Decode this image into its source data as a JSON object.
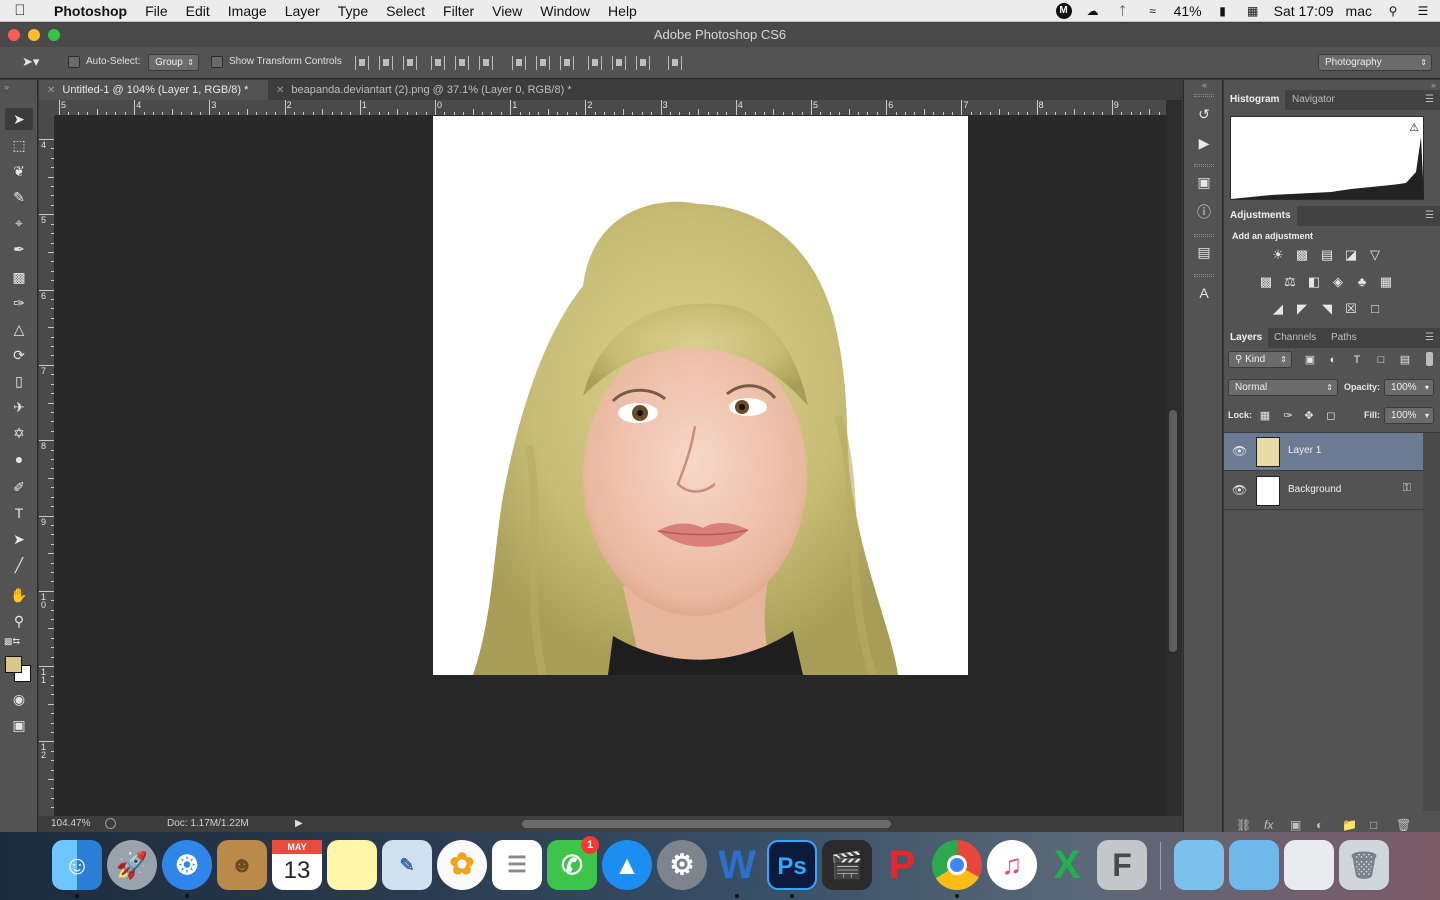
{
  "menubar": {
    "apple": "",
    "app": "Photoshop",
    "items": [
      "File",
      "Edit",
      "Image",
      "Layer",
      "Type",
      "Select",
      "Filter",
      "View",
      "Window",
      "Help"
    ],
    "battery": "41%",
    "clock": "Sat 17:09",
    "user": "mac",
    "status_m": "M"
  },
  "window": {
    "title": "Adobe Photoshop CS6"
  },
  "options": {
    "auto_select_label": "Auto-Select:",
    "auto_select_value": "Group",
    "show_transform_label": "Show Transform Controls",
    "workspace": "Photography"
  },
  "doc_tabs": [
    {
      "label": "Untitled-1 @ 104% (Layer 1, RGB/8) *"
    },
    {
      "label": "beapanda.deviantart (2).png @ 37.1% (Layer 0, RGB/8) *"
    }
  ],
  "hruler_labels": [
    "5",
    "4",
    "3",
    "2",
    "1",
    "0",
    "1",
    "2",
    "3",
    "4",
    "5",
    "6",
    "7",
    "8",
    "9"
  ],
  "vruler_labels": [
    "4",
    "5",
    "6",
    "7",
    "8",
    "9",
    "10",
    "11",
    "12"
  ],
  "status": {
    "zoom": "104.47%",
    "doc": "Doc: 1.17M/1.22M"
  },
  "panels": {
    "histogram_tab": "Histogram",
    "navigator_tab": "Navigator",
    "adjustments_tab": "Adjustments",
    "add_adjustment": "Add an adjustment",
    "layers_tab": "Layers",
    "channels_tab": "Channels",
    "paths_tab": "Paths",
    "kind": "Kind",
    "blend_mode": "Normal",
    "opacity_label": "Opacity:",
    "opacity_value": "100%",
    "lock_label": "Lock:",
    "fill_label": "Fill:",
    "fill_value": "100%",
    "layers": [
      {
        "name": "Layer 1"
      },
      {
        "name": "Background"
      }
    ]
  },
  "dock": {
    "calendar_month": "MAY",
    "calendar_day": "13",
    "facetime_badge": "1",
    "word_letter": "W",
    "ps_letters": "Ps",
    "fontlab_letter": "F"
  },
  "colors": {
    "accent_layer": "#6d7a94",
    "foreground_swatch": "#d8c98a",
    "hair": "#c9c07a"
  }
}
